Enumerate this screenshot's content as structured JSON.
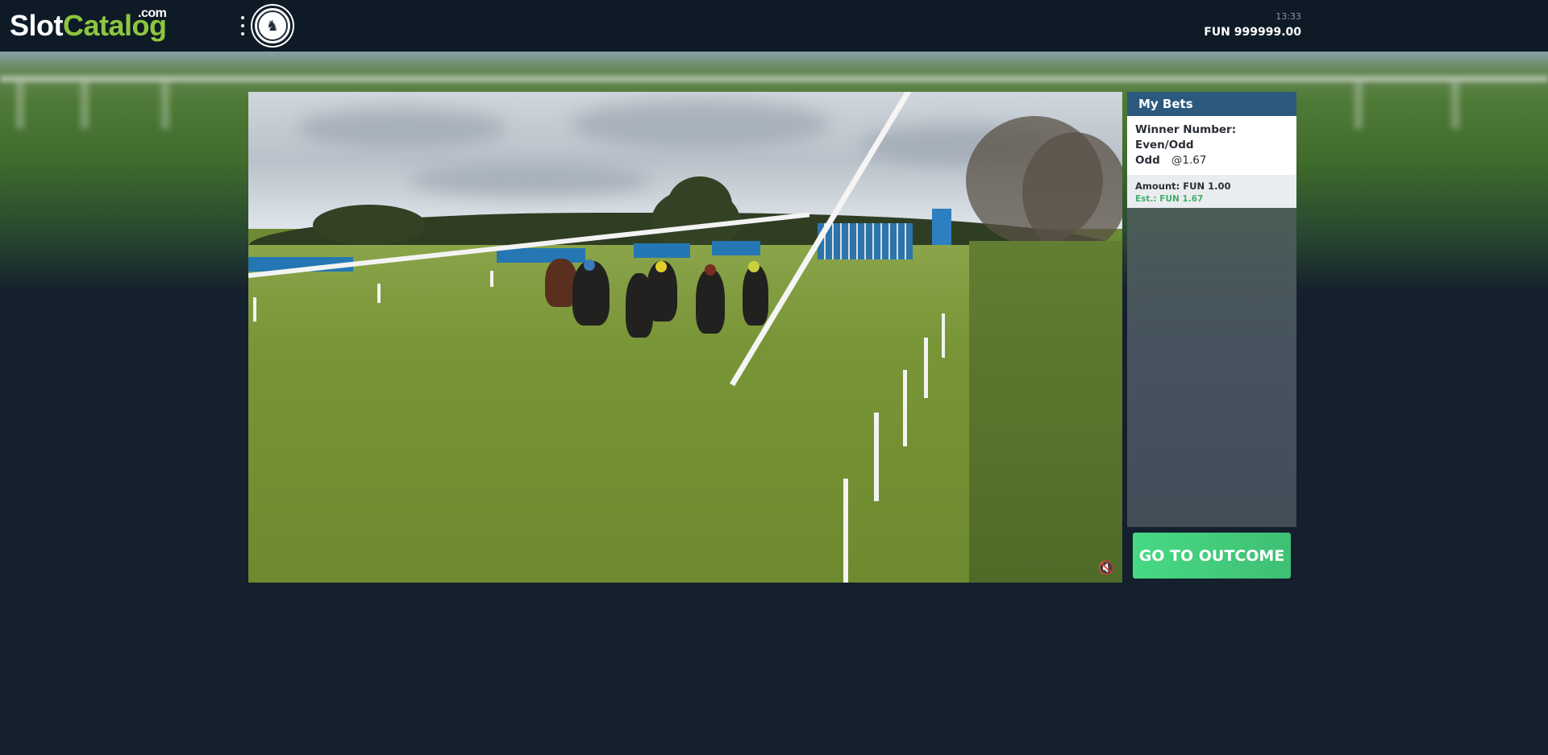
{
  "header": {
    "logo_main": "Slot",
    "logo_accent": "Catalog",
    "logo_suffix": ".com",
    "menu_icon": "vertical-dots-icon",
    "brand_icon": "horse-racing-badge",
    "time": "13:33",
    "balance": "FUN 999999.00"
  },
  "video": {
    "mute_icon": "speaker-muted-icon",
    "mute_glyph": "🔇"
  },
  "my_bets": {
    "title": "My Bets",
    "bets": [
      {
        "selection": "Winner Number: Even/Odd",
        "pick": "Odd",
        "odds": "@1.67",
        "amount": "Amount: FUN 1.00",
        "estimate": "Est.: FUN 1.67"
      }
    ]
  },
  "actions": {
    "go_to_outcome": "GO TO OUTCOME"
  },
  "colors": {
    "header_bg": "#0e1b27",
    "page_bg": "#14202d",
    "accent_green": "#8dc63f",
    "bets_header": "#2b5a7e",
    "outcome_button": "#47d984"
  }
}
